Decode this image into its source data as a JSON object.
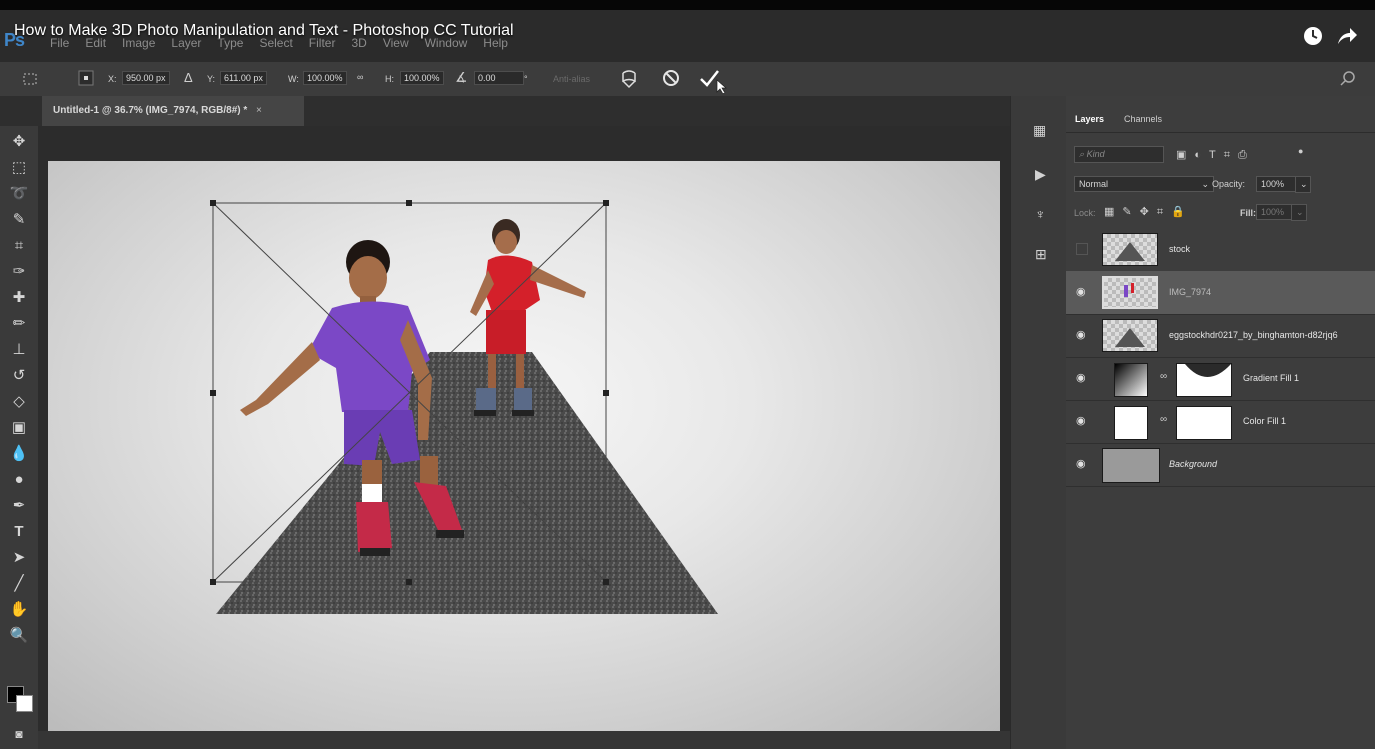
{
  "video": {
    "title": "How to Make 3D Photo Manipulation and Text - Photoshop CC Tutorial"
  },
  "app": {
    "logo": "Ps"
  },
  "menu": [
    "File",
    "Edit",
    "Image",
    "Layer",
    "Type",
    "Select",
    "Filter",
    "3D",
    "View",
    "Window",
    "Help"
  ],
  "options": {
    "x_label": "X:",
    "x_value": "950.00 px",
    "y_label": "Y:",
    "y_value": "611.00 px",
    "w_label": "W:",
    "w_value": "100.00%",
    "h_label": "H:",
    "h_value": "100.00%",
    "angle_value": "0.00",
    "degree": "°",
    "antialias": "Anti-alias"
  },
  "document": {
    "tab_title": "Untitled-1 @ 36.7% (IMG_7974, RGB/8#) *",
    "close": "×"
  },
  "layers_panel": {
    "tabs": [
      "Layers",
      "Channels"
    ],
    "filter_placeholder": "Kind",
    "blend_mode": "Normal",
    "opacity_label": "Opacity:",
    "opacity_value": "100%",
    "lock_label": "Lock:",
    "fill_label": "Fill:",
    "fill_value": "100%",
    "layers": [
      {
        "name": "stock",
        "visible": false
      },
      {
        "name": "IMG_7974",
        "visible": true,
        "selected": true
      },
      {
        "name": "eggstockhdr0217_by_binghamton-d82rjq6",
        "visible": true
      },
      {
        "name": "Gradient Fill 1",
        "visible": true
      },
      {
        "name": "Color Fill 1",
        "visible": true
      },
      {
        "name": "Background",
        "visible": true,
        "italic": true
      }
    ]
  },
  "colors": {
    "accent": "#3f86c9",
    "canvas_bg": "#e8e8e8",
    "boy_shirt": "#7b48c6",
    "boy_back_shirt": "#d4202a"
  }
}
